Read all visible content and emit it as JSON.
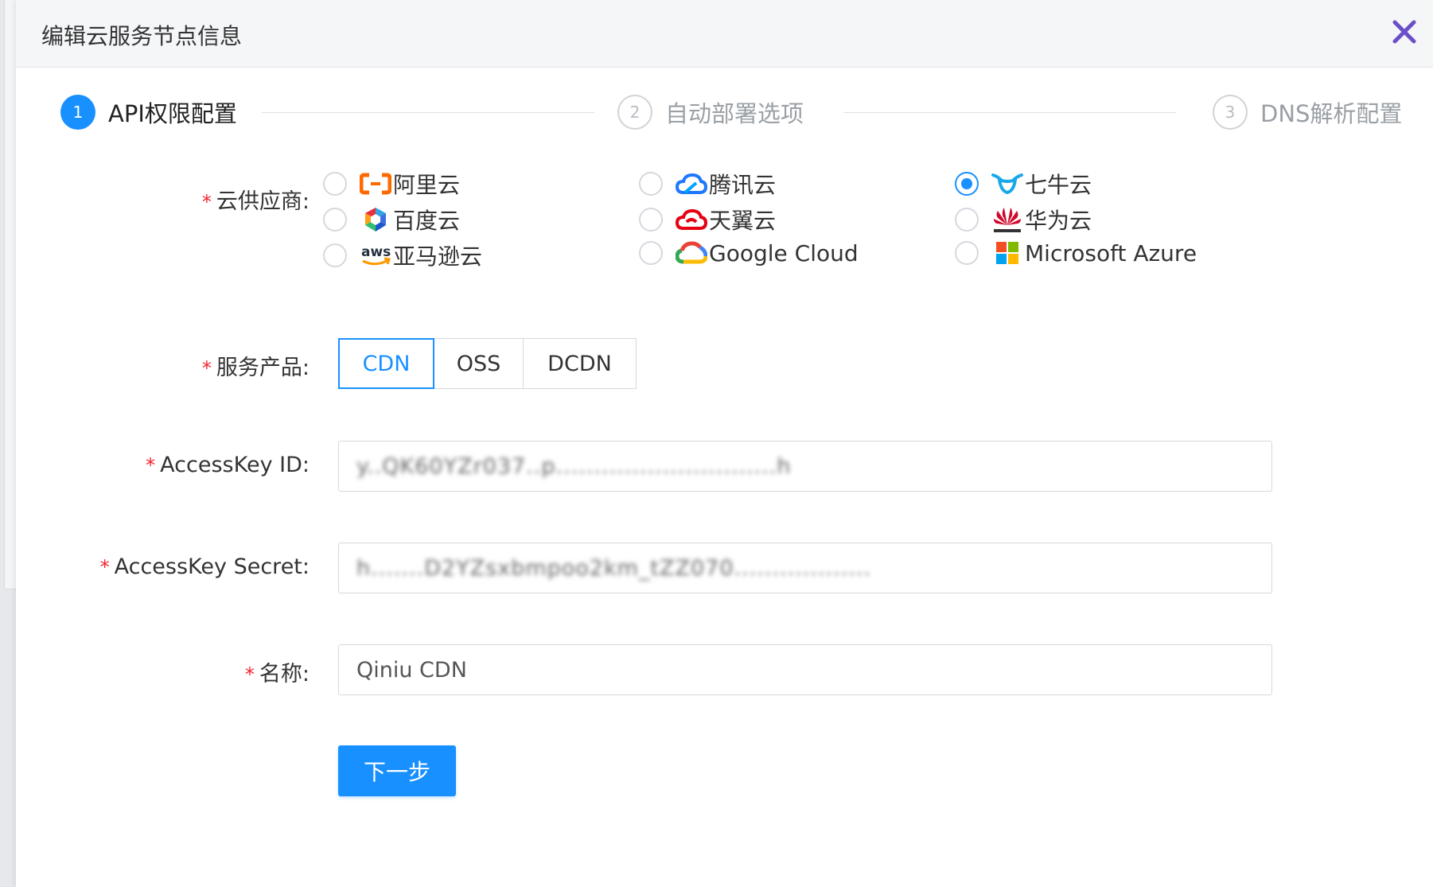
{
  "dialog": {
    "title": "编辑云服务节点信息"
  },
  "steps": [
    {
      "num": "1",
      "label": "API权限配置"
    },
    {
      "num": "2",
      "label": "自动部署选项"
    },
    {
      "num": "3",
      "label": "DNS解析配置"
    }
  ],
  "form": {
    "required_mark": "*",
    "provider": {
      "label": "云供应商:",
      "selected": "七牛云",
      "options": [
        {
          "name": "阿里云",
          "icon": "aliyun-icon",
          "checked": false
        },
        {
          "name": "腾讯云",
          "icon": "tencent-cloud-icon",
          "checked": false
        },
        {
          "name": "七牛云",
          "icon": "qiniu-icon",
          "checked": true
        },
        {
          "name": "百度云",
          "icon": "baidu-cloud-icon",
          "checked": false
        },
        {
          "name": "天翼云",
          "icon": "tianyi-cloud-icon",
          "checked": false
        },
        {
          "name": "华为云",
          "icon": "huawei-icon",
          "checked": false
        },
        {
          "name": "亚马逊云",
          "icon": "aws-icon",
          "checked": false
        },
        {
          "name": "Google Cloud",
          "icon": "google-cloud-icon",
          "checked": false
        },
        {
          "name": "Microsoft Azure",
          "icon": "microsoft-icon",
          "checked": false
        }
      ]
    },
    "product": {
      "label": "服务产品:",
      "options": [
        "CDN",
        "OSS",
        "DCDN"
      ],
      "selected": "CDN"
    },
    "access_key_id": {
      "label": "AccessKey ID:",
      "value": "y..QK60YZr037..p.............................h"
    },
    "access_key_secret": {
      "label": "AccessKey Secret:",
      "value": "h.......D2YZsxbmpoo2km_tZZ070.................."
    },
    "name": {
      "label": "名称:",
      "value": "Qiniu CDN"
    },
    "next_button": "下一步"
  },
  "colors": {
    "primary": "#1890ff",
    "required": "#f5222d",
    "close_icon": "#6a4fc8",
    "aliyun": "#ff6a00",
    "tencent": "#1e78ff",
    "qiniu": "#1aa8e8",
    "tianyi": "#e60012",
    "huawei": "#cf0a2c",
    "aws": "#ff9900"
  }
}
